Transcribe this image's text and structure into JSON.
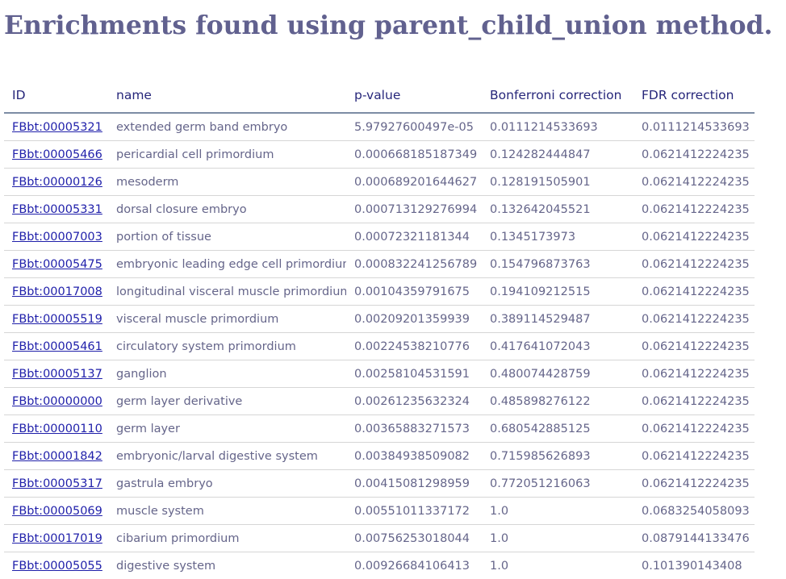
{
  "page": {
    "title": "Enrichments found using parent_child_union method."
  },
  "table": {
    "headers": [
      "ID",
      "name",
      "p-value",
      "Bonferroni correction",
      "FDR correction"
    ],
    "rows": [
      {
        "id": "FBbt:00005321",
        "name": "extended germ band embryo",
        "p_value": "5.97927600497e-05",
        "bonferroni": "0.0111214533693",
        "fdr": "0.0111214533693"
      },
      {
        "id": "FBbt:00005466",
        "name": "pericardial cell primordium",
        "p_value": "0.000668185187349",
        "bonferroni": "0.124282444847",
        "fdr": "0.0621412224235"
      },
      {
        "id": "FBbt:00000126",
        "name": "mesoderm",
        "p_value": "0.000689201644627",
        "bonferroni": "0.128191505901",
        "fdr": "0.0621412224235"
      },
      {
        "id": "FBbt:00005331",
        "name": "dorsal closure embryo",
        "p_value": "0.000713129276994",
        "bonferroni": "0.132642045521",
        "fdr": "0.0621412224235"
      },
      {
        "id": "FBbt:00007003",
        "name": "portion of tissue",
        "p_value": "0.00072321181344",
        "bonferroni": "0.1345173973",
        "fdr": "0.0621412224235"
      },
      {
        "id": "FBbt:00005475",
        "name": "embryonic leading edge cell primordium",
        "p_value": "0.000832241256789",
        "bonferroni": "0.154796873763",
        "fdr": "0.0621412224235"
      },
      {
        "id": "FBbt:00017008",
        "name": "longitudinal visceral muscle primordium",
        "p_value": "0.00104359791675",
        "bonferroni": "0.194109212515",
        "fdr": "0.0621412224235"
      },
      {
        "id": "FBbt:00005519",
        "name": "visceral muscle primordium",
        "p_value": "0.00209201359939",
        "bonferroni": "0.389114529487",
        "fdr": "0.0621412224235"
      },
      {
        "id": "FBbt:00005461",
        "name": "circulatory system primordium",
        "p_value": "0.00224538210776",
        "bonferroni": "0.417641072043",
        "fdr": "0.0621412224235"
      },
      {
        "id": "FBbt:00005137",
        "name": "ganglion",
        "p_value": "0.00258104531591",
        "bonferroni": "0.480074428759",
        "fdr": "0.0621412224235"
      },
      {
        "id": "FBbt:00000000",
        "name": "germ layer derivative",
        "p_value": "0.00261235632324",
        "bonferroni": "0.485898276122",
        "fdr": "0.0621412224235"
      },
      {
        "id": "FBbt:00000110",
        "name": "germ layer",
        "p_value": "0.00365883271573",
        "bonferroni": "0.680542885125",
        "fdr": "0.0621412224235"
      },
      {
        "id": "FBbt:00001842",
        "name": "embryonic/larval digestive system",
        "p_value": "0.00384938509082",
        "bonferroni": "0.715985626893",
        "fdr": "0.0621412224235"
      },
      {
        "id": "FBbt:00005317",
        "name": "gastrula embryo",
        "p_value": "0.00415081298959",
        "bonferroni": "0.772051216063",
        "fdr": "0.0621412224235"
      },
      {
        "id": "FBbt:00005069",
        "name": "muscle system",
        "p_value": "0.00551011337172",
        "bonferroni": "1.0",
        "fdr": "0.0683254058093"
      },
      {
        "id": "FBbt:00017019",
        "name": "cibarium primordium",
        "p_value": "0.00756253018044",
        "bonferroni": "1.0",
        "fdr": "0.0879144133476"
      },
      {
        "id": "FBbt:00005055",
        "name": "digestive system",
        "p_value": "0.00926684106413",
        "bonferroni": "1.0",
        "fdr": "0.101390143408"
      }
    ]
  }
}
